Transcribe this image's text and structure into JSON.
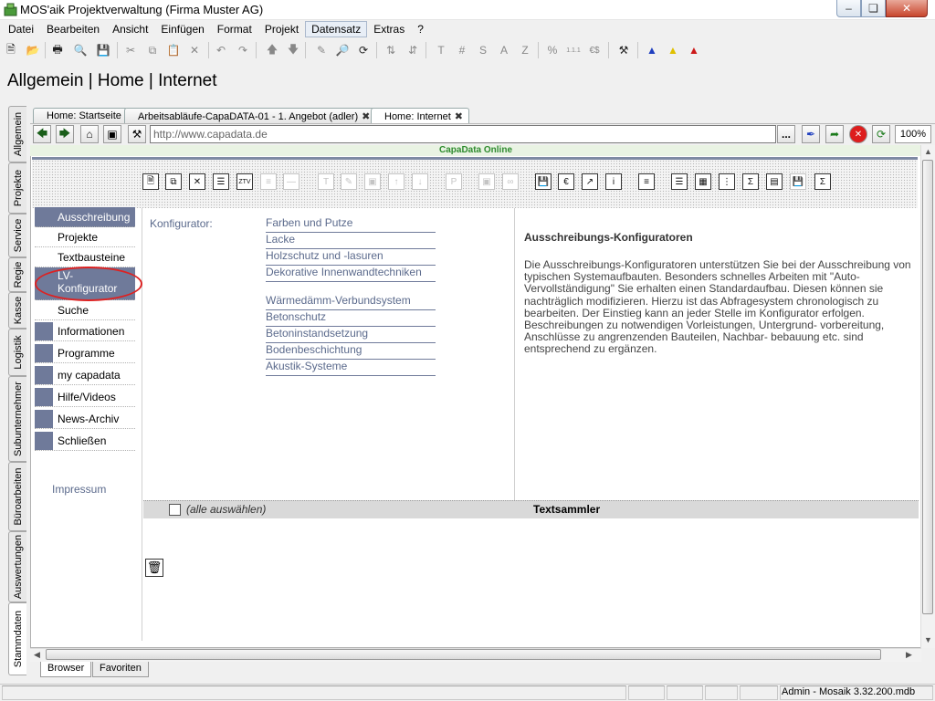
{
  "window": {
    "title": "MOS'aik Projektverwaltung (Firma Muster AG)"
  },
  "menu": [
    "Datei",
    "Bearbeiten",
    "Ansicht",
    "Einfügen",
    "Format",
    "Projekt",
    "Datensatz",
    "Extras",
    "?"
  ],
  "menu_active": "Datensatz",
  "heading": "Allgemein | Home | Internet",
  "side_tabs": [
    "Allgemein",
    "Projekte",
    "Service",
    "Regie",
    "Kasse",
    "Logistik",
    "Subunternehmer",
    "Büroarbeiten",
    "Auswertungen",
    "Stammdaten"
  ],
  "doc_tabs": [
    "Home: Startseite",
    "Arbeitsabläufe-CapaDATA-01 - 1. Angebot (adler)",
    "Home: Internet"
  ],
  "address": {
    "url": "http://www.capadata.de",
    "more": "...",
    "zoom": "100%"
  },
  "site": {
    "title": "CapaData Online",
    "toolbar_text": {
      "ztv": "ZTV",
      "euro": "€",
      "sigma": "Σ",
      "sigma2": "Σ"
    },
    "nav": [
      {
        "label": "Ausschreibung",
        "style": "hl"
      },
      {
        "label": "Projekte",
        "style": "plain"
      },
      {
        "label": "Textbausteine",
        "style": "plain"
      },
      {
        "label": "LV-Konfigurator",
        "style": "hl"
      },
      {
        "label": "Suche",
        "style": "plain"
      },
      {
        "label": "Informationen",
        "style": "sq"
      },
      {
        "label": "Programme",
        "style": "sq"
      },
      {
        "label": "my capadata",
        "style": "sq"
      },
      {
        "label": "Hilfe/Videos",
        "style": "sq"
      },
      {
        "label": "News-Archiv",
        "style": "sq"
      },
      {
        "label": "Schließen",
        "style": "sq"
      }
    ],
    "impressum": "Impressum",
    "konfigurator_label": "Konfigurator:",
    "konfigurator_links": [
      "Farben und Putze",
      "Lacke",
      "Holzschutz und -lasuren",
      "Dekorative Innenwandtechniken",
      "Wärmedämm-Verbundsystem",
      "Betonschutz",
      "Betoninstandsetzung",
      "Bodenbeschichtung",
      "Akustik-Systeme"
    ],
    "description_title": "Ausschreibungs-Konfiguratoren",
    "description_text": "Die Ausschreibungs-Konfiguratoren unterstützen Sie bei der Ausschreibung von typischen Systemaufbauten. Besonders schnelles Arbeiten mit \"Auto-Vervollständigung\" Sie erhalten einen Standardaufbau. Diesen können sie nachträglich modifizieren. Hierzu ist das Abfragesystem chronologisch zu bearbeiten. Der Einstieg kann an jeder Stelle im Konfigurator erfolgen. Beschreibungen zu notwendigen Vorleistungen, Untergrund- vorbereitung, Anschlüsse zu angrenzenden Bauteilen, Nachbar- bebauung etc. sind entsprechend zu ergänzen.",
    "select_all": "(alle auswählen)",
    "textsammler": "Textsammler"
  },
  "bottom_tabs": [
    "Browser",
    "Favoriten"
  ],
  "status": "Admin - Mosaik 3.32.200.mdb",
  "toolbar_text": {
    "T": "T",
    "hash": "#",
    "S": "S",
    "A": "A",
    "Z": "Z",
    "pct": "%",
    "nums": "1.1.1",
    "money": "€$"
  },
  "colors": {
    "nav_blue": "#6f7a9a",
    "link": "#5b6a8c",
    "site_title": "#2e8b2e",
    "highlight_ellipse": "#dd2222"
  }
}
